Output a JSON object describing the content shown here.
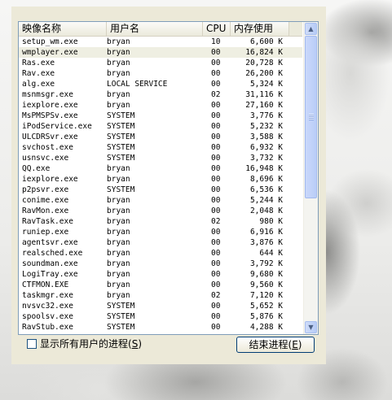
{
  "columns": {
    "name": "映像名称",
    "user": "用户名",
    "cpu": "CPU",
    "mem": "内存使用"
  },
  "processes": [
    {
      "name": "setup_wm.exe",
      "user": "bryan",
      "cpu": "10",
      "mem": "6,600 K"
    },
    {
      "name": "wmplayer.exe",
      "user": "bryan",
      "cpu": "00",
      "mem": "16,824 K"
    },
    {
      "name": "Ras.exe",
      "user": "bryan",
      "cpu": "00",
      "mem": "20,728 K"
    },
    {
      "name": "Rav.exe",
      "user": "bryan",
      "cpu": "00",
      "mem": "26,200 K"
    },
    {
      "name": "alg.exe",
      "user": "LOCAL SERVICE",
      "cpu": "00",
      "mem": "5,324 K"
    },
    {
      "name": "msnmsgr.exe",
      "user": "bryan",
      "cpu": "02",
      "mem": "31,116 K"
    },
    {
      "name": "iexplore.exe",
      "user": "bryan",
      "cpu": "00",
      "mem": "27,160 K"
    },
    {
      "name": "MsPMSPSv.exe",
      "user": "SYSTEM",
      "cpu": "00",
      "mem": "3,776 K"
    },
    {
      "name": "iPodService.exe",
      "user": "SYSTEM",
      "cpu": "00",
      "mem": "5,232 K"
    },
    {
      "name": "ULCDRSvr.exe",
      "user": "SYSTEM",
      "cpu": "00",
      "mem": "3,588 K"
    },
    {
      "name": "svchost.exe",
      "user": "SYSTEM",
      "cpu": "00",
      "mem": "6,932 K"
    },
    {
      "name": "usnsvc.exe",
      "user": "SYSTEM",
      "cpu": "00",
      "mem": "3,732 K"
    },
    {
      "name": "QQ.exe",
      "user": "bryan",
      "cpu": "00",
      "mem": "16,948 K"
    },
    {
      "name": "iexplore.exe",
      "user": "bryan",
      "cpu": "00",
      "mem": "8,696 K"
    },
    {
      "name": "p2psvr.exe",
      "user": "SYSTEM",
      "cpu": "00",
      "mem": "6,536 K"
    },
    {
      "name": "conime.exe",
      "user": "bryan",
      "cpu": "00",
      "mem": "5,244 K"
    },
    {
      "name": "RavMon.exe",
      "user": "bryan",
      "cpu": "00",
      "mem": "2,048 K"
    },
    {
      "name": "RavTask.exe",
      "user": "bryan",
      "cpu": "02",
      "mem": "980 K"
    },
    {
      "name": "runiep.exe",
      "user": "bryan",
      "cpu": "00",
      "mem": "6,916 K"
    },
    {
      "name": "agentsvr.exe",
      "user": "bryan",
      "cpu": "00",
      "mem": "3,876 K"
    },
    {
      "name": "realsched.exe",
      "user": "bryan",
      "cpu": "00",
      "mem": "644 K"
    },
    {
      "name": "soundman.exe",
      "user": "bryan",
      "cpu": "00",
      "mem": "3,792 K"
    },
    {
      "name": "LogiTray.exe",
      "user": "bryan",
      "cpu": "00",
      "mem": "9,680 K"
    },
    {
      "name": "CTFMON.EXE",
      "user": "bryan",
      "cpu": "00",
      "mem": "9,560 K"
    },
    {
      "name": "taskmgr.exe",
      "user": "bryan",
      "cpu": "02",
      "mem": "7,120 K"
    },
    {
      "name": "nvsvc32.exe",
      "user": "SYSTEM",
      "cpu": "00",
      "mem": "5,652 K"
    },
    {
      "name": "spoolsv.exe",
      "user": "SYSTEM",
      "cpu": "00",
      "mem": "5,876 K"
    },
    {
      "name": "RavStub.exe",
      "user": "SYSTEM",
      "cpu": "00",
      "mem": "4,288 K"
    }
  ],
  "selected_row": 1,
  "show_all_users": {
    "label": "显示所有用户的进程",
    "accel": "S",
    "checked": false
  },
  "end_process_button": {
    "label": "结束进程",
    "accel": "E"
  },
  "scrollbar": {
    "up_icon": "scroll-up-arrow-icon",
    "down_icon": "scroll-down-arrow-icon",
    "position_fraction": 0.0
  }
}
